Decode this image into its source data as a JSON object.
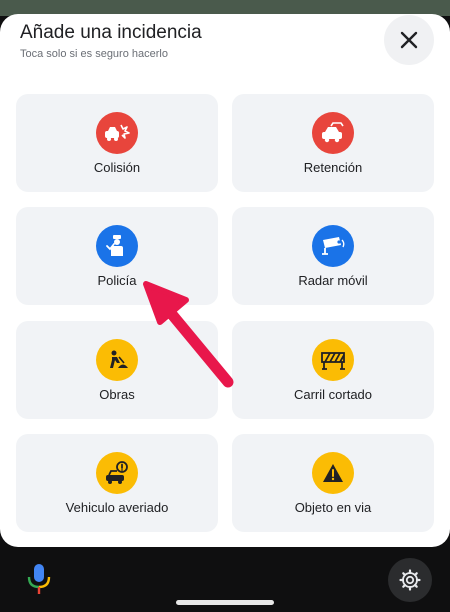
{
  "header": {
    "title": "Añade una incidencia",
    "subtitle": "Toca solo si es seguro hacerlo",
    "close_icon": "close-icon"
  },
  "tiles": [
    {
      "label": "Colisión",
      "icon": "collision-icon",
      "color": "#e8453c"
    },
    {
      "label": "Retención",
      "icon": "traffic-jam-icon",
      "color": "#e8453c"
    },
    {
      "label": "Policía",
      "icon": "police-icon",
      "color": "#1a73e8"
    },
    {
      "label": "Radar móvil",
      "icon": "speed-camera-icon",
      "color": "#1a73e8"
    },
    {
      "label": "Obras",
      "icon": "construction-icon",
      "color": "#fbbc04"
    },
    {
      "label": "Carril cortado",
      "icon": "lane-closed-icon",
      "color": "#fbbc04"
    },
    {
      "label": "Vehiculo averiado",
      "icon": "stalled-vehicle-icon",
      "color": "#fbbc04"
    },
    {
      "label": "Objeto en via",
      "icon": "object-on-road-icon",
      "color": "#fbbc04"
    }
  ],
  "footer": {
    "mic_icon": "microphone-icon",
    "settings_icon": "gear-icon"
  },
  "colors": {
    "tile_bg": "#f1f3f6",
    "annotation_arrow": "#e8174b"
  }
}
